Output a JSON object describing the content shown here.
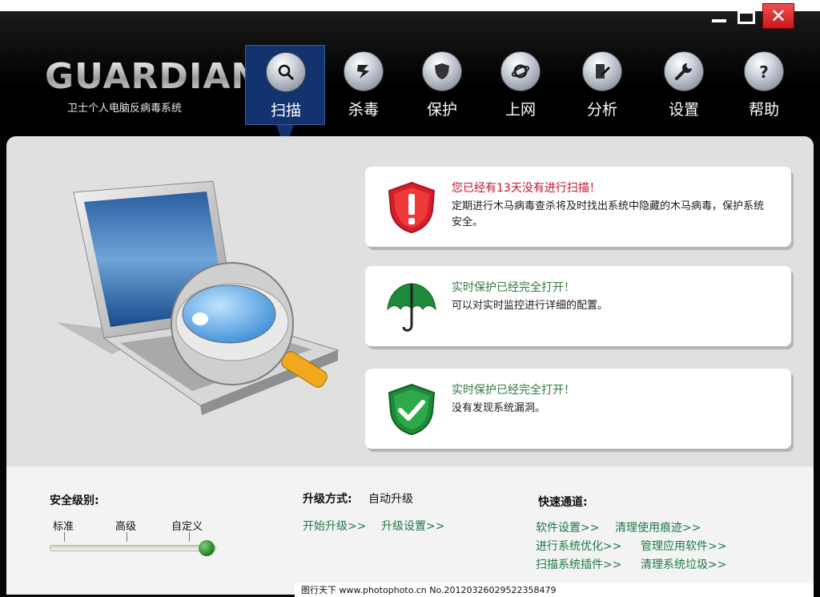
{
  "app": {
    "logo": "GUARDIAN",
    "subtitle": "卫士个人电脑反病毒系统",
    "close_glyph": "✕"
  },
  "nav": {
    "items": [
      {
        "label": "扫描",
        "icon": "search-icon",
        "active": true
      },
      {
        "label": "杀毒",
        "icon": "lightning-icon"
      },
      {
        "label": "保护",
        "icon": "shield-icon"
      },
      {
        "label": "上网",
        "icon": "internet-icon"
      },
      {
        "label": "分析",
        "icon": "document-icon"
      },
      {
        "label": "设置",
        "icon": "wrench-icon"
      },
      {
        "label": "帮助",
        "icon": "help-icon"
      }
    ]
  },
  "cards": [
    {
      "title": "您已经有13天没有进行扫描！",
      "desc": "定期进行木马病毒查杀将及时找出系统中隐藏的木马病毒，保护系统安全。",
      "icon": "alert-shield-icon",
      "color": "#c4122e"
    },
    {
      "title": "实时保护已经完全打开！",
      "desc": "可以对实时监控进行详细的配置。",
      "icon": "umbrella-icon",
      "color": "#2f7a3f"
    },
    {
      "title": "实时保护已经完全打开！",
      "desc": "没有发现系统漏洞。",
      "icon": "check-shield-icon",
      "color": "#2f7a3f"
    }
  ],
  "security": {
    "label": "安全级别:",
    "levels": [
      "标准",
      "高级",
      "自定义"
    ]
  },
  "upgrade": {
    "label": "升级方式:",
    "value": "自动升级",
    "start": "开始升级>>",
    "settings": "升级设置>>"
  },
  "quick": {
    "label": "快速通道:",
    "links": [
      "软件设置>>",
      "清理使用痕迹>>",
      "进行系统优化>>",
      "管理应用软件>>",
      "扫描系统插件>>",
      "清理系统垃圾>>"
    ]
  },
  "watermark": "图行天下 www.photophoto.cn No.20120326029522358479"
}
